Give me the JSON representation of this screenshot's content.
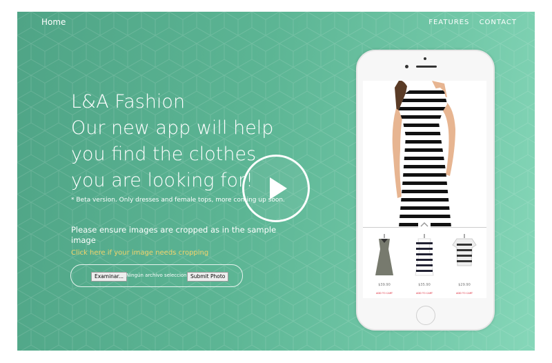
{
  "nav": {
    "home_label": "Home",
    "features_label": "FEATURES",
    "contact_label": "CONTACT"
  },
  "hero": {
    "title_line1": "L&A Fashion",
    "title_line2": "Our new app will help",
    "title_line3": "you find the clothes",
    "title_line4": "you are looking for!",
    "beta_note": "* Beta version. Only dresses and female tops, more coming up soon.",
    "instructions": "Please ensure images are cropped as in the sample image",
    "crop_link": "Click here if your image needs cropping"
  },
  "upload": {
    "browse_label": "Examinar...",
    "file_status": "Ningún archivo seleccionado.",
    "submit_label": "Submit Photo"
  },
  "phone": {
    "products": [
      {
        "price": "$39.90",
        "action": "ADD TO CART"
      },
      {
        "price": "$35.90",
        "action": "ADD TO CART"
      },
      {
        "price": "$29.90",
        "action": "ADD TO CART"
      }
    ]
  },
  "colors": {
    "accent": "#5cb594",
    "link": "#f2d36b"
  },
  "icons": {
    "play": "play-icon",
    "chevron": "chevron-up-icon"
  }
}
